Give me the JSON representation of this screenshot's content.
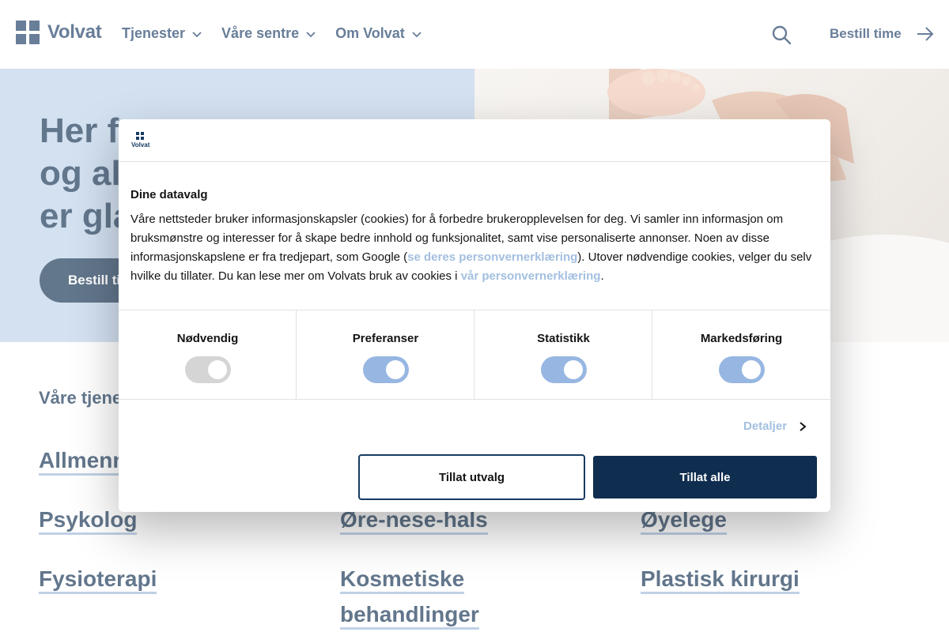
{
  "header": {
    "logo_text": "Volvat",
    "nav": [
      {
        "label": "Tjenester"
      },
      {
        "label": "Våre sentre"
      },
      {
        "label": "Om Volvat"
      }
    ],
    "book_label": "Bestill time"
  },
  "hero": {
    "title_lines": [
      "Her f",
      "og al",
      "er gla"
    ],
    "button_label": "Bestill ti"
  },
  "services": {
    "title": "Våre tjene",
    "items": [
      {
        "label": "Allmenn"
      },
      {
        "label": "Psykolog"
      },
      {
        "label": "Øre-nese-hals"
      },
      {
        "label": "Øyelege"
      },
      {
        "label": "Fysioterapi"
      },
      {
        "label": "Kosmetiske behandlinger"
      },
      {
        "label": "Plastisk kirurgi"
      }
    ]
  },
  "consent": {
    "logo_text": "Volvat",
    "heading": "Dine datavalg",
    "body_part1": "Våre nettsteder bruker informasjonskapsler (cookies) for å forbedre brukeropplevelsen for deg. Vi samler inn informasjon om bruksmønstre og interesser for å skape bedre innhold og funksjonalitet, samt vise personaliserte annonser. Noen av disse informasjonskapslene er fra tredjepart, som Google (",
    "link1": "se deres personvernerklæring",
    "body_part2": "). Utover nødvendige cookies, velger du selv hvilke du tillater. Du kan lese mer om Volvats bruk av cookies i ",
    "link2": "vår personvernerklæring",
    "body_part3": ".",
    "categories": [
      {
        "label": "Nødvendig",
        "enabled": true,
        "locked": true
      },
      {
        "label": "Preferanser",
        "enabled": true,
        "locked": false
      },
      {
        "label": "Statistikk",
        "enabled": true,
        "locked": false
      },
      {
        "label": "Markedsføring",
        "enabled": true,
        "locked": false
      }
    ],
    "details_label": "Detaljer",
    "allow_selection_label": "Tillat utvalg",
    "allow_all_label": "Tillat alle"
  }
}
